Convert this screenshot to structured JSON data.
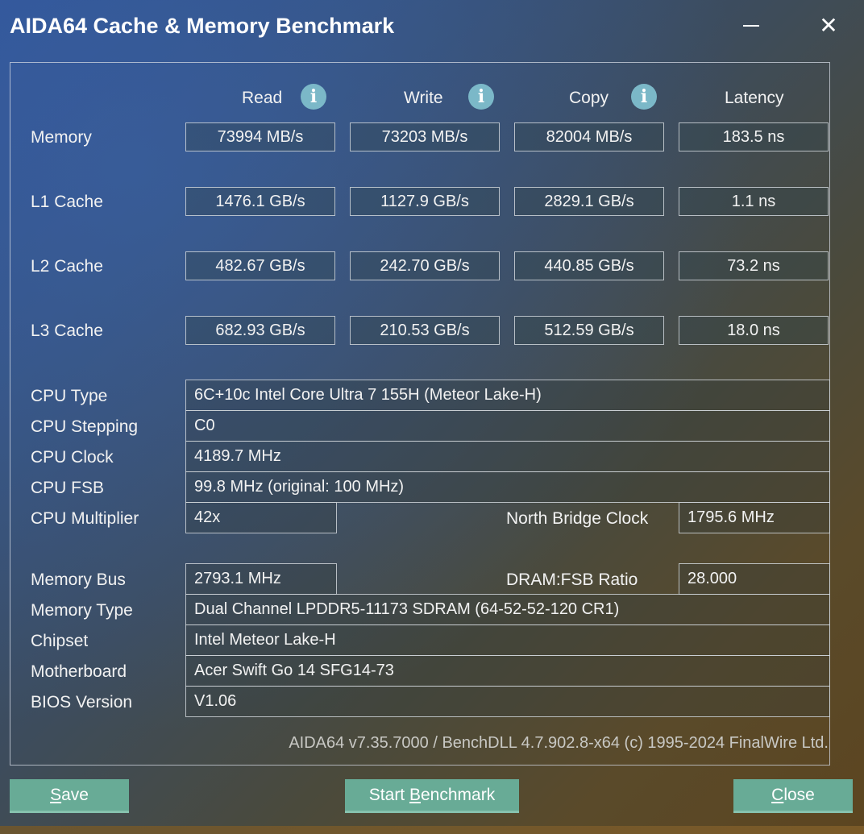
{
  "window": {
    "title": "AIDA64 Cache & Memory Benchmark",
    "minimize_icon": "minimize-icon",
    "close_icon": "close-icon",
    "close_glyph": "✕"
  },
  "columns": {
    "read": "Read",
    "write": "Write",
    "copy": "Copy",
    "latency": "Latency",
    "info_glyph": "i"
  },
  "benchmarks": [
    {
      "label": "Memory",
      "read": "73994 MB/s",
      "write": "73203 MB/s",
      "copy": "82004 MB/s",
      "latency": "183.5 ns"
    },
    {
      "label": "L1 Cache",
      "read": "1476.1 GB/s",
      "write": "1127.9 GB/s",
      "copy": "2829.1 GB/s",
      "latency": "1.1 ns"
    },
    {
      "label": "L2 Cache",
      "read": "482.67 GB/s",
      "write": "242.70 GB/s",
      "copy": "440.85 GB/s",
      "latency": "73.2 ns"
    },
    {
      "label": "L3 Cache",
      "read": "682.93 GB/s",
      "write": "210.53 GB/s",
      "copy": "512.59 GB/s",
      "latency": "18.0 ns"
    }
  ],
  "info": {
    "cpu_type": {
      "label": "CPU Type",
      "value": "6C+10c Intel Core Ultra 7 155H  (Meteor Lake-H)"
    },
    "cpu_stepping": {
      "label": "CPU Stepping",
      "value": "C0"
    },
    "cpu_clock": {
      "label": "CPU Clock",
      "value": "4189.7 MHz"
    },
    "cpu_fsb": {
      "label": "CPU FSB",
      "value": "99.8 MHz  (original: 100 MHz)"
    },
    "cpu_multiplier": {
      "label": "CPU Multiplier",
      "value": "42x"
    },
    "north_bridge_clock": {
      "label": "North Bridge Clock",
      "value": "1795.6 MHz"
    },
    "memory_bus": {
      "label": "Memory Bus",
      "value": "2793.1 MHz"
    },
    "dram_fsb_ratio": {
      "label": "DRAM:FSB Ratio",
      "value": "28.000"
    },
    "memory_type": {
      "label": "Memory Type",
      "value": "Dual Channel LPDDR5-11173 SDRAM  (64-52-52-120 CR1)"
    },
    "chipset": {
      "label": "Chipset",
      "value": "Intel Meteor Lake-H"
    },
    "motherboard": {
      "label": "Motherboard",
      "value": "Acer Swift Go 14 SFG14-73"
    },
    "bios_version": {
      "label": "BIOS Version",
      "value": "V1.06"
    }
  },
  "footer": {
    "version_text": "AIDA64 v7.35.7000 / BenchDLL 4.7.902.8-x64  (c) 1995-2024 FinalWire Ltd."
  },
  "buttons": {
    "save": {
      "accel": "S",
      "rest": "ave"
    },
    "start": {
      "pre": "Start ",
      "accel": "B",
      "rest": "enchmark"
    },
    "close": {
      "accel": "C",
      "rest": "lose"
    }
  },
  "colors": {
    "button_bg": "#68ab96",
    "info_icon": "#7bb8c8"
  }
}
